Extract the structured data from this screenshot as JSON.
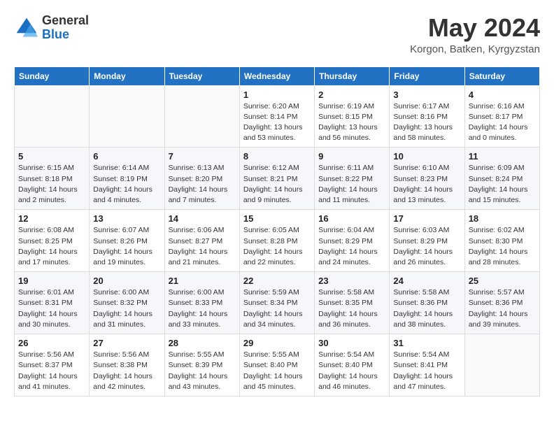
{
  "header": {
    "logo_line1": "General",
    "logo_line2": "Blue",
    "month_title": "May 2024",
    "location": "Korgon, Batken, Kyrgyzstan"
  },
  "days_of_week": [
    "Sunday",
    "Monday",
    "Tuesday",
    "Wednesday",
    "Thursday",
    "Friday",
    "Saturday"
  ],
  "weeks": [
    [
      {
        "day": "",
        "info": ""
      },
      {
        "day": "",
        "info": ""
      },
      {
        "day": "",
        "info": ""
      },
      {
        "day": "1",
        "info": "Sunrise: 6:20 AM\nSunset: 8:14 PM\nDaylight: 13 hours\nand 53 minutes."
      },
      {
        "day": "2",
        "info": "Sunrise: 6:19 AM\nSunset: 8:15 PM\nDaylight: 13 hours\nand 56 minutes."
      },
      {
        "day": "3",
        "info": "Sunrise: 6:17 AM\nSunset: 8:16 PM\nDaylight: 13 hours\nand 58 minutes."
      },
      {
        "day": "4",
        "info": "Sunrise: 6:16 AM\nSunset: 8:17 PM\nDaylight: 14 hours\nand 0 minutes."
      }
    ],
    [
      {
        "day": "5",
        "info": "Sunrise: 6:15 AM\nSunset: 8:18 PM\nDaylight: 14 hours\nand 2 minutes."
      },
      {
        "day": "6",
        "info": "Sunrise: 6:14 AM\nSunset: 8:19 PM\nDaylight: 14 hours\nand 4 minutes."
      },
      {
        "day": "7",
        "info": "Sunrise: 6:13 AM\nSunset: 8:20 PM\nDaylight: 14 hours\nand 7 minutes."
      },
      {
        "day": "8",
        "info": "Sunrise: 6:12 AM\nSunset: 8:21 PM\nDaylight: 14 hours\nand 9 minutes."
      },
      {
        "day": "9",
        "info": "Sunrise: 6:11 AM\nSunset: 8:22 PM\nDaylight: 14 hours\nand 11 minutes."
      },
      {
        "day": "10",
        "info": "Sunrise: 6:10 AM\nSunset: 8:23 PM\nDaylight: 14 hours\nand 13 minutes."
      },
      {
        "day": "11",
        "info": "Sunrise: 6:09 AM\nSunset: 8:24 PM\nDaylight: 14 hours\nand 15 minutes."
      }
    ],
    [
      {
        "day": "12",
        "info": "Sunrise: 6:08 AM\nSunset: 8:25 PM\nDaylight: 14 hours\nand 17 minutes."
      },
      {
        "day": "13",
        "info": "Sunrise: 6:07 AM\nSunset: 8:26 PM\nDaylight: 14 hours\nand 19 minutes."
      },
      {
        "day": "14",
        "info": "Sunrise: 6:06 AM\nSunset: 8:27 PM\nDaylight: 14 hours\nand 21 minutes."
      },
      {
        "day": "15",
        "info": "Sunrise: 6:05 AM\nSunset: 8:28 PM\nDaylight: 14 hours\nand 22 minutes."
      },
      {
        "day": "16",
        "info": "Sunrise: 6:04 AM\nSunset: 8:29 PM\nDaylight: 14 hours\nand 24 minutes."
      },
      {
        "day": "17",
        "info": "Sunrise: 6:03 AM\nSunset: 8:29 PM\nDaylight: 14 hours\nand 26 minutes."
      },
      {
        "day": "18",
        "info": "Sunrise: 6:02 AM\nSunset: 8:30 PM\nDaylight: 14 hours\nand 28 minutes."
      }
    ],
    [
      {
        "day": "19",
        "info": "Sunrise: 6:01 AM\nSunset: 8:31 PM\nDaylight: 14 hours\nand 30 minutes."
      },
      {
        "day": "20",
        "info": "Sunrise: 6:00 AM\nSunset: 8:32 PM\nDaylight: 14 hours\nand 31 minutes."
      },
      {
        "day": "21",
        "info": "Sunrise: 6:00 AM\nSunset: 8:33 PM\nDaylight: 14 hours\nand 33 minutes."
      },
      {
        "day": "22",
        "info": "Sunrise: 5:59 AM\nSunset: 8:34 PM\nDaylight: 14 hours\nand 34 minutes."
      },
      {
        "day": "23",
        "info": "Sunrise: 5:58 AM\nSunset: 8:35 PM\nDaylight: 14 hours\nand 36 minutes."
      },
      {
        "day": "24",
        "info": "Sunrise: 5:58 AM\nSunset: 8:36 PM\nDaylight: 14 hours\nand 38 minutes."
      },
      {
        "day": "25",
        "info": "Sunrise: 5:57 AM\nSunset: 8:36 PM\nDaylight: 14 hours\nand 39 minutes."
      }
    ],
    [
      {
        "day": "26",
        "info": "Sunrise: 5:56 AM\nSunset: 8:37 PM\nDaylight: 14 hours\nand 41 minutes."
      },
      {
        "day": "27",
        "info": "Sunrise: 5:56 AM\nSunset: 8:38 PM\nDaylight: 14 hours\nand 42 minutes."
      },
      {
        "day": "28",
        "info": "Sunrise: 5:55 AM\nSunset: 8:39 PM\nDaylight: 14 hours\nand 43 minutes."
      },
      {
        "day": "29",
        "info": "Sunrise: 5:55 AM\nSunset: 8:40 PM\nDaylight: 14 hours\nand 45 minutes."
      },
      {
        "day": "30",
        "info": "Sunrise: 5:54 AM\nSunset: 8:40 PM\nDaylight: 14 hours\nand 46 minutes."
      },
      {
        "day": "31",
        "info": "Sunrise: 5:54 AM\nSunset: 8:41 PM\nDaylight: 14 hours\nand 47 minutes."
      },
      {
        "day": "",
        "info": ""
      }
    ]
  ]
}
